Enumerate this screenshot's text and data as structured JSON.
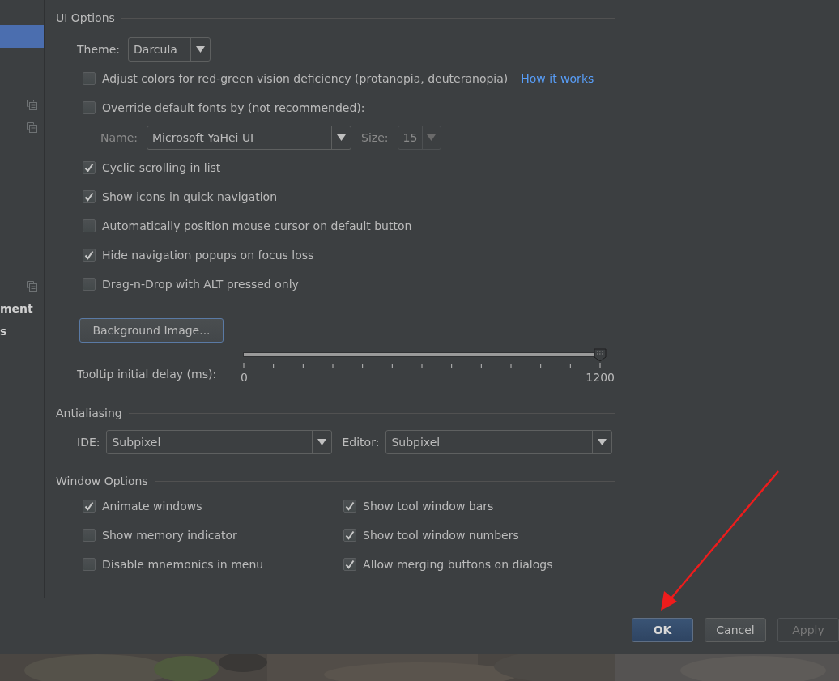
{
  "sidebar": {
    "items": [
      {
        "selected": true,
        "shared": false
      },
      {
        "selected": false,
        "shared": false
      },
      {
        "selected": false,
        "shared": false
      },
      {
        "selected": false,
        "shared": true
      },
      {
        "selected": false,
        "shared": true
      },
      {
        "selected": false,
        "shared": false
      },
      {
        "selected": false,
        "shared": false
      },
      {
        "selected": false,
        "shared": false
      },
      {
        "selected": false,
        "shared": false
      },
      {
        "selected": false,
        "shared": false
      },
      {
        "selected": false,
        "shared": false
      },
      {
        "selected": false,
        "shared": true
      },
      {
        "selected": false,
        "shared": false,
        "label": "ment"
      },
      {
        "selected": false,
        "shared": false,
        "label": "s"
      }
    ]
  },
  "ui_options": {
    "title": "UI Options",
    "rows": [
      {
        "kind": "dropdown",
        "label": "Theme:",
        "value": "Darcula"
      },
      {
        "kind": "checkbox",
        "label": "Adjust colors for red-green vision deficiency (protanopia, deuteranopia)",
        "checked": false,
        "link": "How it works"
      },
      {
        "kind": "checkbox",
        "label": "Override default fonts by (not recommended):",
        "checked": false
      },
      {
        "kind": "font",
        "name_label": "Name:",
        "name_value": "Microsoft YaHei UI",
        "size_label": "Size:",
        "size_value": "15",
        "disabled": true
      },
      {
        "kind": "checkbox",
        "label": "Cyclic scrolling in list",
        "checked": true
      },
      {
        "kind": "checkbox",
        "label": "Show icons in quick navigation",
        "checked": true
      },
      {
        "kind": "checkbox",
        "label": "Automatically position mouse cursor on default button",
        "checked": false
      },
      {
        "kind": "checkbox",
        "label": "Hide navigation popups on focus loss",
        "checked": true
      },
      {
        "kind": "checkbox",
        "label": "Drag-n-Drop with ALT pressed only",
        "checked": false
      },
      {
        "kind": "button",
        "label": "Background Image..."
      },
      {
        "kind": "slider",
        "label": "Tooltip initial delay (ms):",
        "level": 1,
        "min_label": "0",
        "max_label": "1200"
      }
    ]
  },
  "antialiasing": {
    "title": "Antialiasing",
    "fields": [
      {
        "label": "IDE:",
        "value": "Subpixel"
      },
      {
        "label": "Editor:",
        "value": "Subpixel"
      }
    ]
  },
  "window_options": {
    "title": "Window Options",
    "columns": [
      [
        {
          "label": "Animate windows",
          "checked": true
        },
        {
          "label": "Show memory indicator",
          "checked": false
        },
        {
          "label": "Disable mnemonics in menu",
          "checked": false
        }
      ],
      [
        {
          "label": "Show tool window bars",
          "checked": true
        },
        {
          "label": "Show tool window numbers",
          "checked": true
        },
        {
          "label": "Allow merging buttons on dialogs",
          "checked": true
        }
      ]
    ]
  },
  "buttons": [
    {
      "label": "OK",
      "default": true,
      "disabled": false
    },
    {
      "label": "Cancel",
      "default": false,
      "disabled": false
    },
    {
      "label": "Apply",
      "default": false,
      "disabled": true
    }
  ]
}
